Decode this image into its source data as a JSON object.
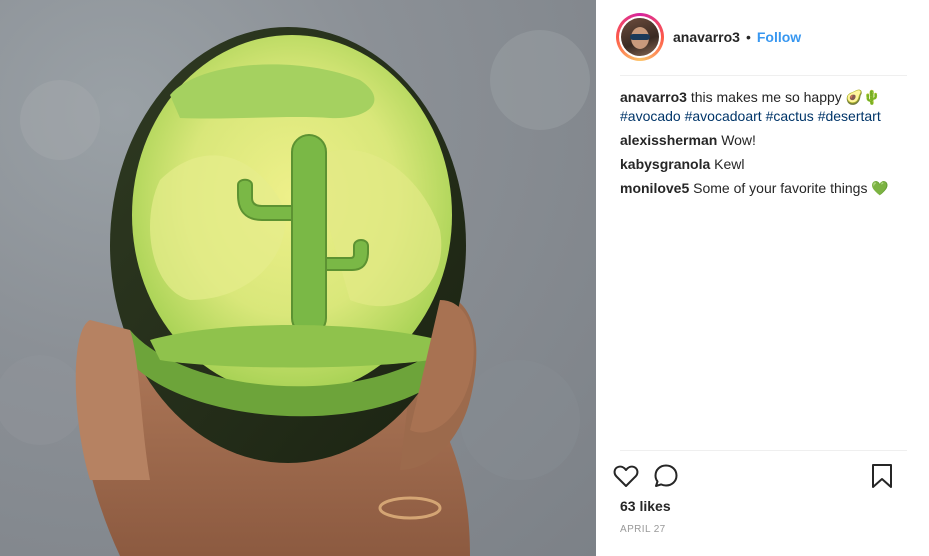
{
  "post": {
    "username": "anavarro3",
    "separator": "•",
    "follow_label": "Follow",
    "likes": "63 likes",
    "date": "APRIL 27"
  },
  "caption": {
    "author": "anavarro3",
    "text": "this makes me so happy",
    "emojis": "🥑🌵",
    "hashtags": [
      "#avocado",
      "#avocadoart",
      "#cactus",
      "#desertart"
    ]
  },
  "comments": [
    {
      "author": "alexissherman",
      "text": "Wow!"
    },
    {
      "author": "kabysgranola",
      "text": "Kewl"
    },
    {
      "author": "monilove5",
      "text": "Some of your favorite things",
      "emoji": "💚"
    }
  ],
  "icons": {
    "like": "heart-icon",
    "comment": "speech-bubble-icon",
    "save": "bookmark-icon"
  },
  "colors": {
    "follow": "#3897f0",
    "hashtag": "#003569",
    "text": "#262626",
    "muted": "#999999"
  }
}
